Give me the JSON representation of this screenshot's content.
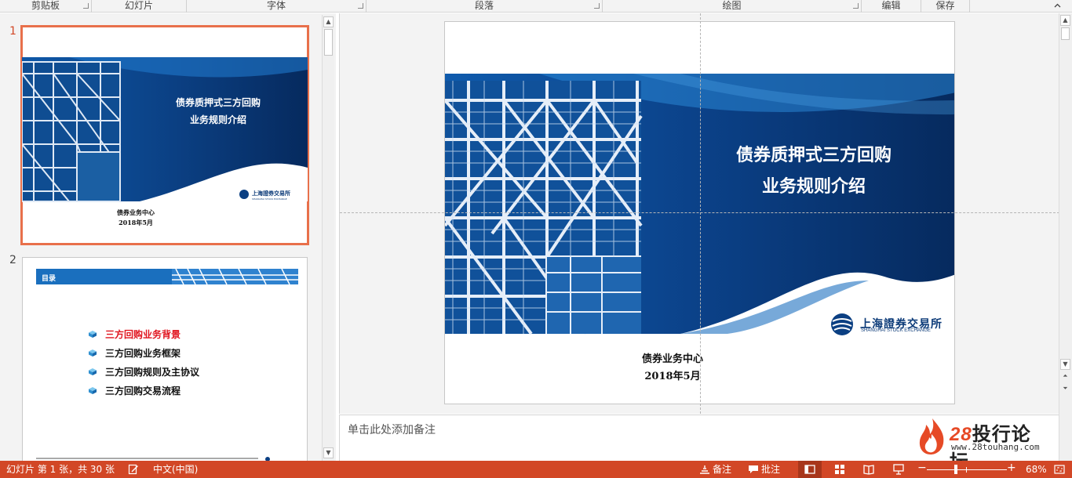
{
  "ribbon": {
    "groups": [
      {
        "label": "剪贴板",
        "launcher": true
      },
      {
        "label": "幻灯片",
        "launcher": false
      },
      {
        "label": "字体",
        "launcher": true
      },
      {
        "label": "段落",
        "launcher": true
      },
      {
        "label": "绘图",
        "launcher": true
      },
      {
        "label": "编辑",
        "launcher": false
      },
      {
        "label": "保存",
        "launcher": false
      }
    ]
  },
  "thumbnails": [
    {
      "number": "1",
      "selected": true,
      "title_line1": "债券质押式三方回购",
      "title_line2": "业务规则介绍",
      "logo_text": "上海證券交易所",
      "logo_sub": "SHANGHAI STOCK EXCHANGE",
      "footer_line1": "债券业务中心",
      "footer_line2": "2018年5月"
    },
    {
      "number": "2",
      "selected": false,
      "header_label": "目录",
      "toc": [
        {
          "text": "三方回购业务背景",
          "color": "#e0141e"
        },
        {
          "text": "三方回购业务框架",
          "color": "#111111"
        },
        {
          "text": "三方回购规则及主协议",
          "color": "#111111"
        },
        {
          "text": "三方回购交易流程",
          "color": "#111111"
        }
      ]
    }
  ],
  "main_slide": {
    "title_line1": "债券质押式三方回购",
    "title_line2": "业务规则介绍",
    "logo_text": "上海證券交易所",
    "logo_sub": "SHANGHAI STOCK EXCHANGE",
    "footer_line1": "债券业务中心",
    "footer_line2": "2018年5月"
  },
  "notes": {
    "placeholder": "单击此处添加备注"
  },
  "watermark": {
    "num": "28",
    "name": "投行论坛",
    "url": "www.28touhang.com"
  },
  "status_bar": {
    "slide_info": "幻灯片 第 1 张，共 30 张",
    "language": "中文(中国)",
    "notes_label": "备注",
    "comments_label": "批注",
    "zoom_minus": "−",
    "zoom_plus": "+",
    "zoom": "68%",
    "zoom_fraction": 0.36
  },
  "colors": {
    "accent": "#d24726",
    "slide_blue_dark": "#0b3a78",
    "slide_blue": "#1565b5",
    "selection": "#e8704b"
  }
}
